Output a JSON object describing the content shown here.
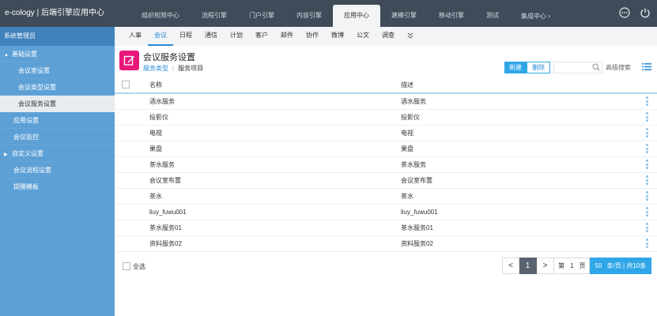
{
  "brand": "e-cology | 后端引擎应用中心",
  "top_tabs": [
    {
      "label": "组织权限中心"
    },
    {
      "label": "流程引擎"
    },
    {
      "label": "门户引擎"
    },
    {
      "label": "内容引擎"
    },
    {
      "label": "应用中心",
      "active": true
    },
    {
      "label": "建模引擎"
    },
    {
      "label": "移动引擎"
    },
    {
      "label": "测试"
    },
    {
      "label": "集成中心"
    }
  ],
  "top_icons": [
    "more-icon",
    "power-icon"
  ],
  "sidebar": {
    "header": "系统管理员",
    "items": [
      {
        "label": "基础设置",
        "level": 1,
        "expanded": true
      },
      {
        "label": "会议室设置",
        "level": 2
      },
      {
        "label": "会议类型设置",
        "level": 2
      },
      {
        "label": "会议服务设置",
        "level": 2,
        "active": true
      },
      {
        "label": "应用设置",
        "level": 1
      },
      {
        "label": "会议监控",
        "level": 1
      },
      {
        "label": "自定义设置",
        "level": 1,
        "collapsed": true
      },
      {
        "label": "会议流程设置",
        "level": 1
      },
      {
        "label": "提醒模板",
        "level": 1
      }
    ]
  },
  "subnav": {
    "tabs": [
      "人事",
      "会议",
      "日程",
      "通信",
      "计划",
      "客户",
      "邮件",
      "协作",
      "微博",
      "公文",
      "调查"
    ],
    "active": "会议",
    "more_icon": "double-chevron-down-icon"
  },
  "page": {
    "title": "会议服务设置",
    "link_type": "服务类型",
    "link_item": "服务项目",
    "new_label": "新建",
    "delete_label": "删除",
    "search_placeholder": "",
    "advanced_search": "高级搜索"
  },
  "table": {
    "columns": [
      "名称",
      "描述"
    ],
    "rows": [
      [
        "酒水服务",
        "酒水服务"
      ],
      [
        "投影仪",
        "投影仪"
      ],
      [
        "电视",
        "电视"
      ],
      [
        "果盘",
        "果盘"
      ],
      [
        "茶水服务",
        "茶水服务"
      ],
      [
        "会议室布置",
        "会议室布置"
      ],
      [
        "茶水",
        "茶水"
      ],
      [
        "liuy_fuwu001",
        "liuy_fuwu001"
      ],
      [
        "茶水服务01",
        "茶水服务01"
      ],
      [
        "资料服务02",
        "资料服务02"
      ]
    ]
  },
  "footer": {
    "select_all": "全选",
    "prev": "<",
    "current_page": "1",
    "next": ">",
    "page_prefix": "第",
    "page_input": "1",
    "page_suffix": "页",
    "per_page": "50",
    "per_page_suffix": "条/页 | 共10条"
  },
  "colors": {
    "topbar": "#3f4b59",
    "sidebar": "#5da0d6",
    "accent": "#2fa6e8",
    "page_icon": "#e8177a"
  }
}
